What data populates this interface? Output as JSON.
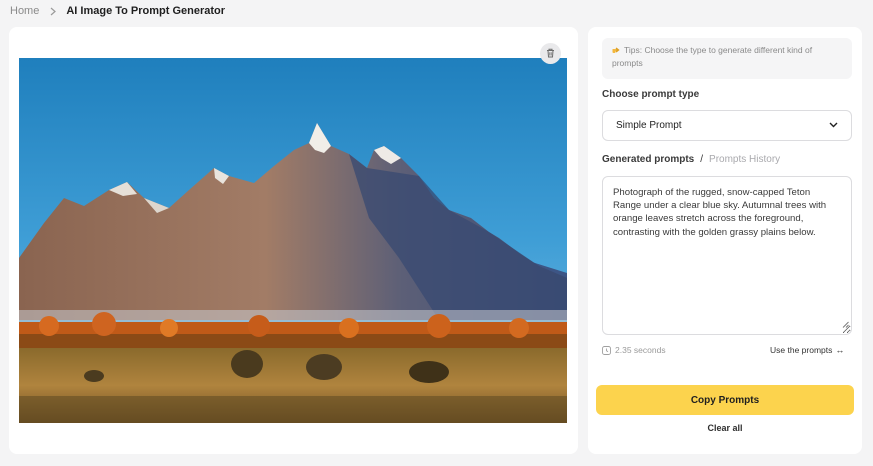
{
  "breadcrumb": {
    "home": "Home",
    "current": "AI Image To Prompt Generator"
  },
  "image_panel": {
    "delete_icon": "trash-icon",
    "image_alt": "Snow-capped Teton Range with autumn trees and grassy plains"
  },
  "tips": {
    "icon": "pointing-hand-icon",
    "text": "Tips: Choose the type to generate different kind of prompts"
  },
  "prompt_type": {
    "label": "Choose prompt type",
    "selected": "Simple Prompt"
  },
  "generated": {
    "tab_active": "Generated prompts",
    "divider": "/",
    "tab_history": "Prompts History",
    "text": "Photograph of the rugged, snow-capped Teton Range under a clear blue sky. Autumnal trees with orange leaves stretch across the foreground, contrasting with the golden grassy plains below."
  },
  "meta": {
    "duration": "2.35 seconds",
    "use_prompts": "Use the prompts",
    "use_arrow": "↔"
  },
  "actions": {
    "copy": "Copy Prompts",
    "clear": "Clear all"
  },
  "colors": {
    "accent": "#fcd34d",
    "background": "#f4f4f5",
    "card": "#ffffff"
  }
}
